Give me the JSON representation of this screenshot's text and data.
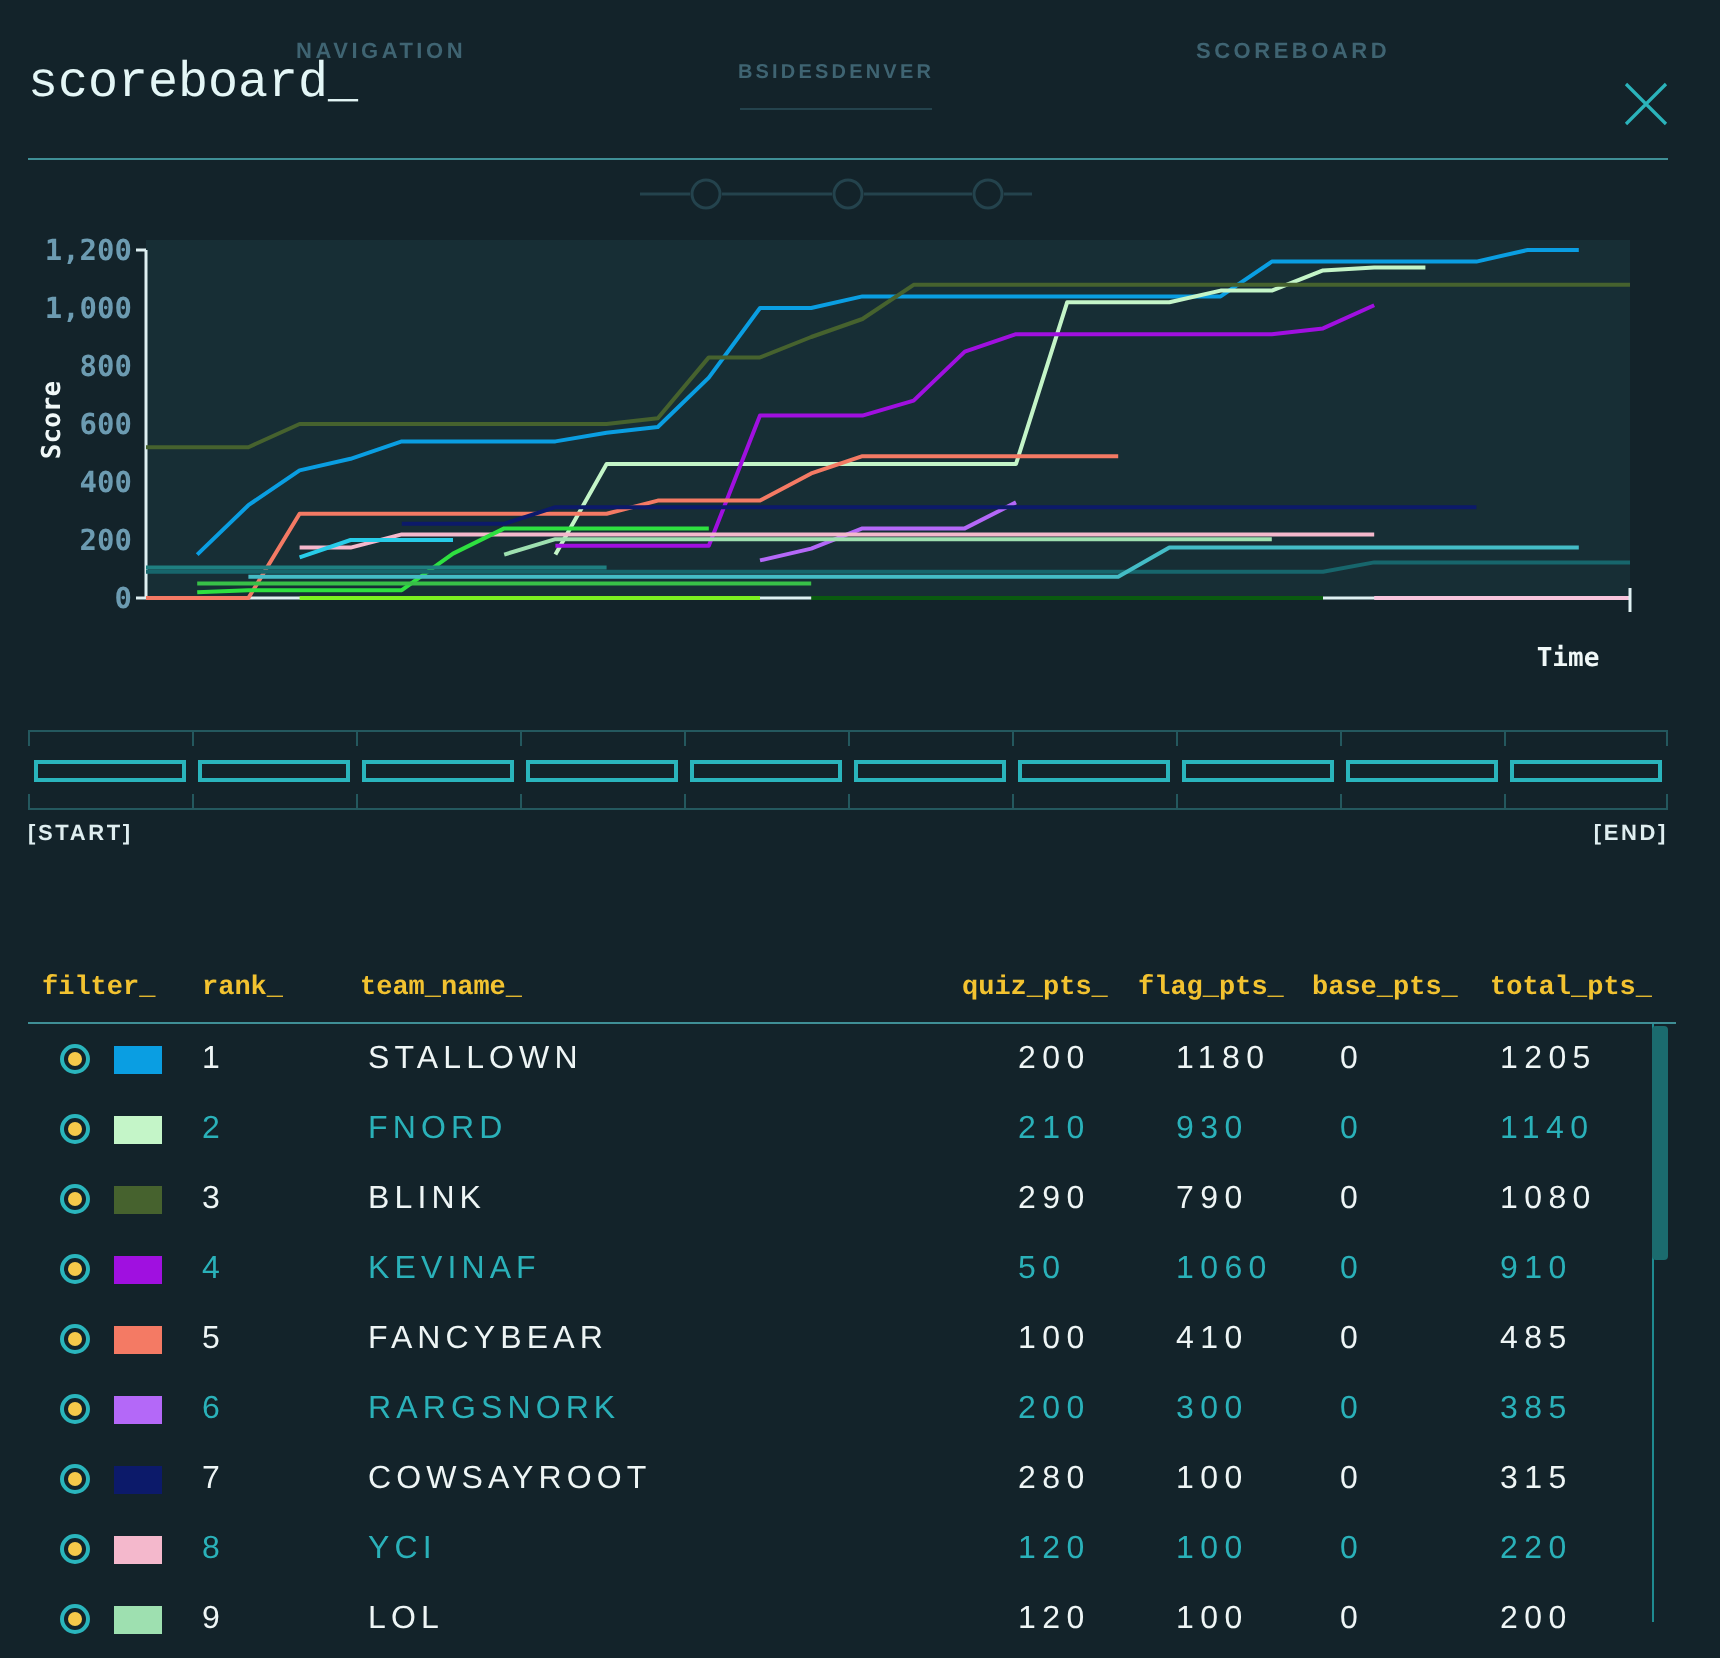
{
  "background_nav": [
    {
      "label": "NAVIGATION",
      "kind": "link"
    },
    {
      "label": "BSIDESDENVER",
      "kind": "brand"
    },
    {
      "label": "SCOREBOARD",
      "kind": "link"
    }
  ],
  "window": {
    "title": "scoreboard_"
  },
  "chart": {
    "chart_data": {
      "type": "line",
      "xlabel": "Time",
      "ylabel": "Score",
      "ylim": [
        0,
        1200
      ],
      "yticks": [
        0,
        200,
        400,
        600,
        800,
        {
          "value": 1000,
          "label": "1,000"
        },
        {
          "value": 1200,
          "label": "1,200"
        }
      ],
      "series": [
        {
          "color": "#0a9ee2",
          "values": [
            null,
            150,
            320,
            440,
            480,
            540,
            540,
            540,
            540,
            570,
            590,
            760,
            1000,
            1000,
            1040,
            1040,
            1040,
            1040,
            1040,
            1040,
            1040,
            1040,
            1160,
            1160,
            1160,
            1160,
            1160,
            1200,
            1200,
            null
          ]
        },
        {
          "color": "#c4f5c8",
          "values": [
            null,
            null,
            null,
            null,
            null,
            null,
            null,
            null,
            150,
            462,
            462,
            462,
            462,
            462,
            462,
            462,
            462,
            462,
            1020,
            1020,
            1020,
            1060,
            1060,
            1130,
            1140,
            1140,
            null,
            null,
            null,
            null
          ]
        },
        {
          "color": "#46622e",
          "values": [
            520,
            520,
            520,
            600,
            600,
            600,
            600,
            600,
            600,
            600,
            620,
            830,
            830,
            900,
            962,
            1080,
            1080,
            1080,
            1080,
            1080,
            1080,
            1080,
            1080,
            1080,
            1080,
            1080,
            1080,
            1080,
            1080,
            1080
          ]
        },
        {
          "color": "#a010e0",
          "values": [
            null,
            null,
            null,
            null,
            null,
            null,
            null,
            null,
            180,
            180,
            180,
            180,
            629,
            629,
            629,
            681,
            850,
            910,
            910,
            910,
            910,
            910,
            910,
            930,
            1010,
            null,
            null,
            null,
            null,
            null
          ]
        },
        {
          "color": "#f47a64",
          "values": [
            0,
            0,
            0,
            290,
            290,
            290,
            290,
            290,
            290,
            290,
            336,
            336,
            336,
            430,
            489,
            489,
            489,
            489,
            489,
            489,
            null,
            null,
            null,
            null,
            null,
            null,
            null,
            null,
            null,
            null
          ]
        },
        {
          "color": "#b468f8",
          "values": [
            null,
            null,
            null,
            null,
            null,
            null,
            null,
            null,
            null,
            null,
            null,
            null,
            130,
            170,
            240,
            240,
            240,
            330,
            null,
            null,
            null,
            null,
            null,
            null,
            null,
            null,
            null,
            null,
            null,
            null
          ]
        },
        {
          "color": "#0c1a6a",
          "values": [
            null,
            null,
            null,
            null,
            null,
            256,
            256,
            256,
            313,
            313,
            313,
            313,
            313,
            313,
            313,
            313,
            313,
            313,
            313,
            313,
            313,
            313,
            313,
            313,
            313,
            313,
            313,
            null,
            null,
            null
          ]
        },
        {
          "color": "#f4b8cc",
          "values": [
            null,
            null,
            null,
            174,
            174,
            219,
            219,
            219,
            219,
            219,
            219,
            219,
            219,
            219,
            219,
            219,
            219,
            219,
            219,
            219,
            219,
            219,
            219,
            219,
            219,
            null,
            null,
            null,
            null,
            null
          ]
        },
        {
          "color": "#9ee0b0",
          "values": [
            null,
            null,
            null,
            null,
            null,
            null,
            null,
            150,
            203,
            203,
            203,
            203,
            203,
            203,
            203,
            203,
            203,
            203,
            203,
            203,
            203,
            203,
            203,
            null,
            null,
            null,
            null,
            null,
            null,
            null
          ]
        },
        {
          "color": "#2ee040",
          "values": [
            null,
            20,
            27,
            27,
            27,
            27,
            153,
            240,
            240,
            240,
            240,
            240,
            null,
            null,
            null,
            null,
            null,
            null,
            null,
            null,
            null,
            null,
            null,
            null,
            null,
            null,
            null,
            null,
            null,
            null
          ]
        },
        {
          "color": "#7cf020",
          "values": [
            null,
            null,
            null,
            0,
            0,
            0,
            0,
            0,
            0,
            0,
            0,
            0,
            0,
            null,
            null,
            null,
            null,
            null,
            null,
            null,
            null,
            null,
            null,
            null,
            null,
            null,
            null,
            null,
            null,
            null
          ]
        },
        {
          "color": "#0a5a10",
          "values": [
            null,
            null,
            null,
            null,
            null,
            null,
            null,
            null,
            null,
            null,
            null,
            null,
            null,
            0,
            0,
            0,
            0,
            0,
            0,
            0,
            0,
            0,
            0,
            0,
            null,
            null,
            null,
            null,
            null,
            null
          ]
        },
        {
          "color": "#f8c4dc",
          "values": [
            null,
            null,
            null,
            null,
            null,
            null,
            null,
            null,
            null,
            null,
            null,
            null,
            null,
            null,
            null,
            null,
            null,
            null,
            null,
            null,
            null,
            null,
            null,
            null,
            0,
            0,
            0,
            0,
            0,
            0
          ]
        },
        {
          "color": "#38c048",
          "values": [
            null,
            50,
            50,
            50,
            50,
            50,
            50,
            50,
            50,
            50,
            50,
            50,
            50,
            50,
            null,
            null,
            null,
            null,
            null,
            null,
            null,
            null,
            null,
            null,
            null,
            null,
            null,
            null,
            null,
            null
          ]
        },
        {
          "color": "#17666c",
          "values": [
            90,
            90,
            90,
            90,
            90,
            90,
            90,
            90,
            90,
            90,
            90,
            90,
            90,
            90,
            90,
            90,
            90,
            90,
            90,
            90,
            90,
            90,
            90,
            90,
            123,
            123,
            123,
            123,
            123,
            123
          ]
        },
        {
          "color": "#1f7f80",
          "values": [
            105,
            105,
            105,
            105,
            105,
            105,
            105,
            105,
            105,
            105,
            null,
            null,
            null,
            null,
            null,
            null,
            null,
            null,
            null,
            null,
            null,
            null,
            null,
            null,
            null,
            null,
            null,
            null,
            null,
            null
          ]
        },
        {
          "color": "#44bcc6",
          "values": [
            null,
            null,
            73,
            73,
            73,
            73,
            73,
            73,
            73,
            73,
            73,
            73,
            73,
            73,
            73,
            73,
            73,
            73,
            73,
            73,
            174,
            174,
            174,
            174,
            174,
            174,
            174,
            174,
            174,
            null
          ]
        },
        {
          "color": "#28cce8",
          "values": [
            null,
            null,
            null,
            140,
            200,
            200,
            200,
            null,
            null,
            null,
            null,
            null,
            null,
            null,
            null,
            null,
            null,
            null,
            null,
            null,
            null,
            null,
            null,
            null,
            null,
            null,
            null,
            null,
            null,
            null
          ]
        }
      ]
    }
  },
  "timeline": {
    "segments": [
      {
        "selected": false
      },
      {
        "selected": false
      },
      {
        "selected": false
      },
      {
        "selected": false
      },
      {
        "selected": false
      },
      {
        "selected": false
      },
      {
        "selected": false
      },
      {
        "selected": false
      },
      {
        "selected": false
      },
      {
        "selected": false
      }
    ],
    "start_label": "[START]",
    "end_label": "[END]"
  },
  "table": {
    "columns": [
      "filter_",
      "rank_",
      "team_name_",
      "quiz_pts_",
      "flag_pts_",
      "base_pts_",
      "total_pts_"
    ],
    "rows": [
      {
        "checked": true,
        "color": "#0a9ee2",
        "rank": "1",
        "team_name": "STALLOWN",
        "quiz_pts": "200",
        "flag_pts": "1180",
        "base_pts": "0",
        "total_pts": "1205"
      },
      {
        "checked": true,
        "color": "#c4f5c8",
        "rank": "2",
        "team_name": "FNORD",
        "quiz_pts": "210",
        "flag_pts": "930",
        "base_pts": "0",
        "total_pts": "1140"
      },
      {
        "checked": true,
        "color": "#46622e",
        "rank": "3",
        "team_name": "BLINK",
        "quiz_pts": "290",
        "flag_pts": "790",
        "base_pts": "0",
        "total_pts": "1080"
      },
      {
        "checked": true,
        "color": "#a010e0",
        "rank": "4",
        "team_name": "KEVINAF",
        "quiz_pts": "50",
        "flag_pts": "1060",
        "base_pts": "0",
        "total_pts": "910"
      },
      {
        "checked": true,
        "color": "#f47a64",
        "rank": "5",
        "team_name": "FANCYBEAR",
        "quiz_pts": "100",
        "flag_pts": "410",
        "base_pts": "0",
        "total_pts": "485"
      },
      {
        "checked": true,
        "color": "#b468f8",
        "rank": "6",
        "team_name": "RARGSNORK",
        "quiz_pts": "200",
        "flag_pts": "300",
        "base_pts": "0",
        "total_pts": "385"
      },
      {
        "checked": true,
        "color": "#0c1a6a",
        "rank": "7",
        "team_name": "COWSAYROOT",
        "quiz_pts": "280",
        "flag_pts": "100",
        "base_pts": "0",
        "total_pts": "315"
      },
      {
        "checked": true,
        "color": "#f4b8cc",
        "rank": "8",
        "team_name": "YCI",
        "quiz_pts": "120",
        "flag_pts": "100",
        "base_pts": "0",
        "total_pts": "220"
      },
      {
        "checked": true,
        "color": "#9ee0b0",
        "rank": "9",
        "team_name": "LOL",
        "quiz_pts": "120",
        "flag_pts": "100",
        "base_pts": "0",
        "total_pts": "200"
      }
    ]
  }
}
